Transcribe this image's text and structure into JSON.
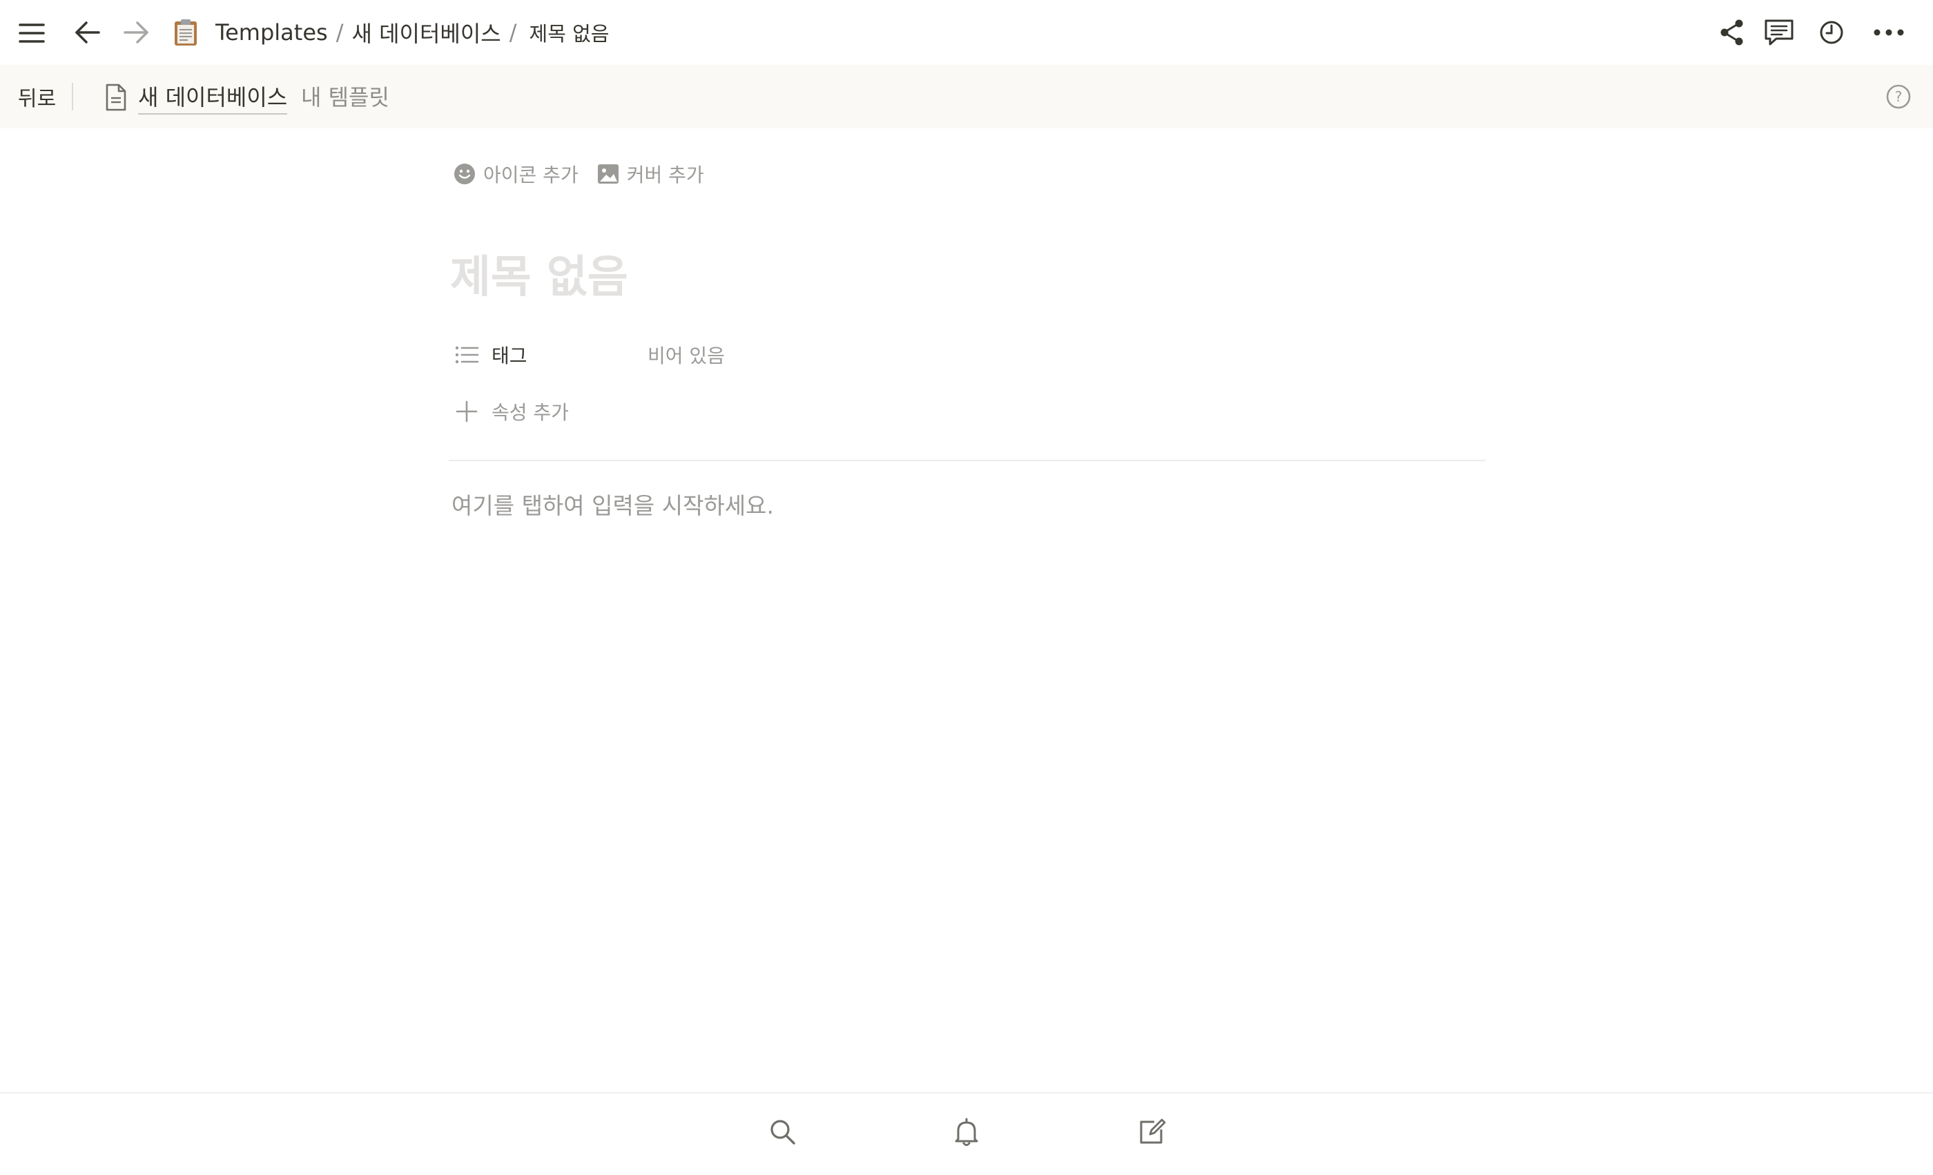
{
  "topbar": {
    "breadcrumb": {
      "workspace": "Templates",
      "separator": "/",
      "database": "새 데이터베이스",
      "current": "제목 없음"
    },
    "icons": {
      "menu": "hamburger-menu-icon",
      "back": "arrow-left-icon",
      "forward": "arrow-right-icon",
      "page": "clipboard-icon",
      "share": "share-icon",
      "comments": "comment-icon",
      "history": "clock-icon",
      "more": "more-dots-icon"
    }
  },
  "banner": {
    "back_label": "뒤로",
    "database_link": "새 데이터베이스",
    "template_label": "내 템플릿"
  },
  "page": {
    "add_icon_label": "아이콘 추가",
    "add_cover_label": "커버 추가",
    "title_placeholder": "제목 없음",
    "properties": [
      {
        "name": "태그",
        "value": "비어 있음"
      }
    ],
    "add_property_label": "속성 추가",
    "body_placeholder": "여기를 탭하여 입력을 시작하세요."
  },
  "bottombar": {
    "icons": [
      "search-icon",
      "bell-icon",
      "compose-icon"
    ]
  },
  "colors": {
    "text": "#37352f",
    "muted": "#9b9a97",
    "banner_bg": "#fbf9f5",
    "title_placeholder": "#e3e2e0"
  }
}
